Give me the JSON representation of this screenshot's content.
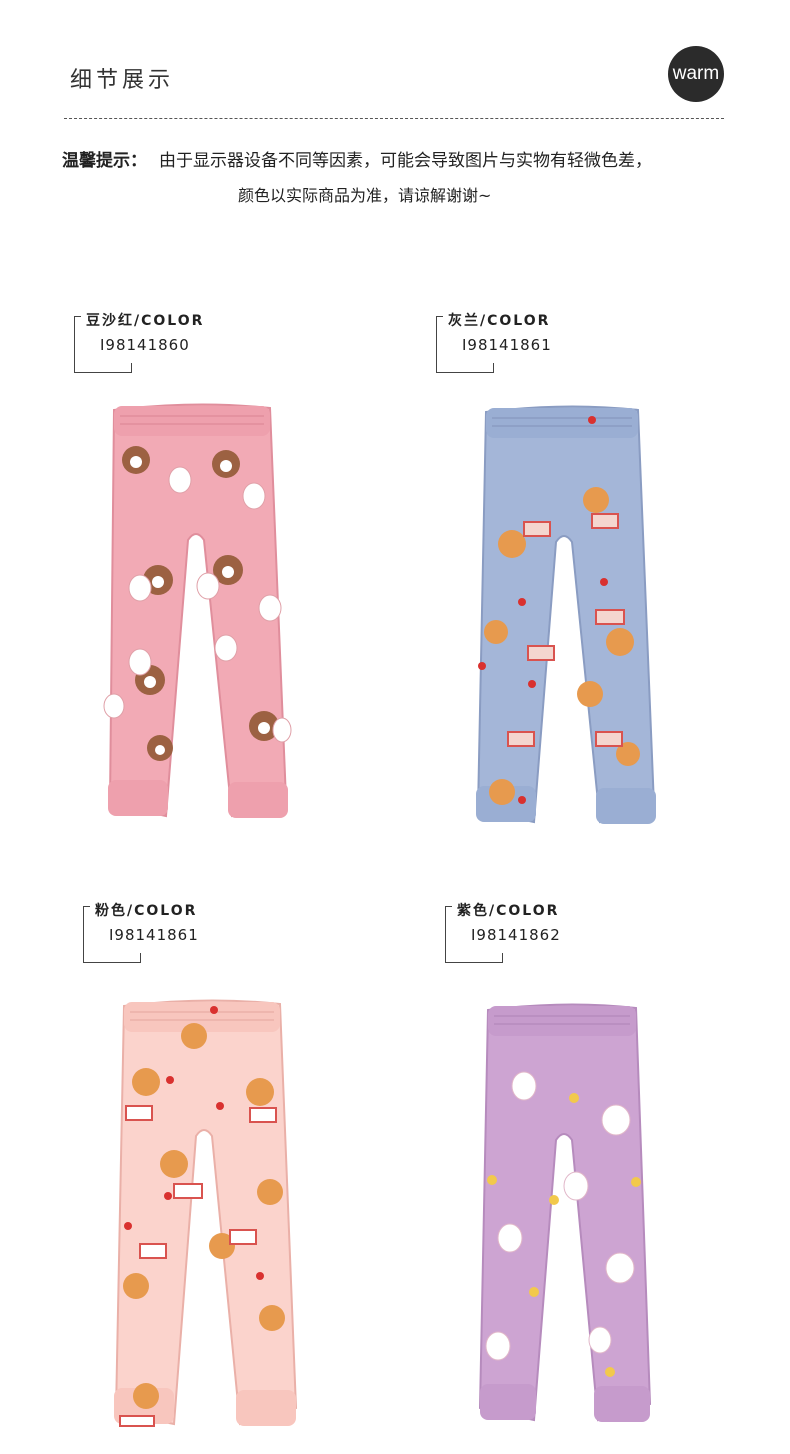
{
  "header": {
    "title": "细节展示",
    "badge": "warm"
  },
  "notice": {
    "label": "温馨提示：",
    "line1": "由于显示器设备不同等因素，可能会导致图片与实物有轻微色差，",
    "line2": "颜色以实际商品为准，请谅解谢谢~"
  },
  "variants": [
    {
      "name": "豆沙红/COLOR",
      "code": "I98141860",
      "fabric_color": "#f2aab5",
      "print_motif": "brown-bear-and-bunny-pattern"
    },
    {
      "name": "灰兰/COLOR",
      "code": "I98141861",
      "fabric_color": "#a4b6d8",
      "print_motif": "choco-bear-and-cake-pattern"
    },
    {
      "name": "粉色/COLOR",
      "code": "I98141861",
      "fabric_color": "#fbd3cc",
      "print_motif": "choco-bear-and-cake-pattern"
    },
    {
      "name": "紫色/COLOR",
      "code": "I98141862",
      "fabric_color": "#cda4d2",
      "print_motif": "bunny-and-shell-pattern"
    }
  ]
}
